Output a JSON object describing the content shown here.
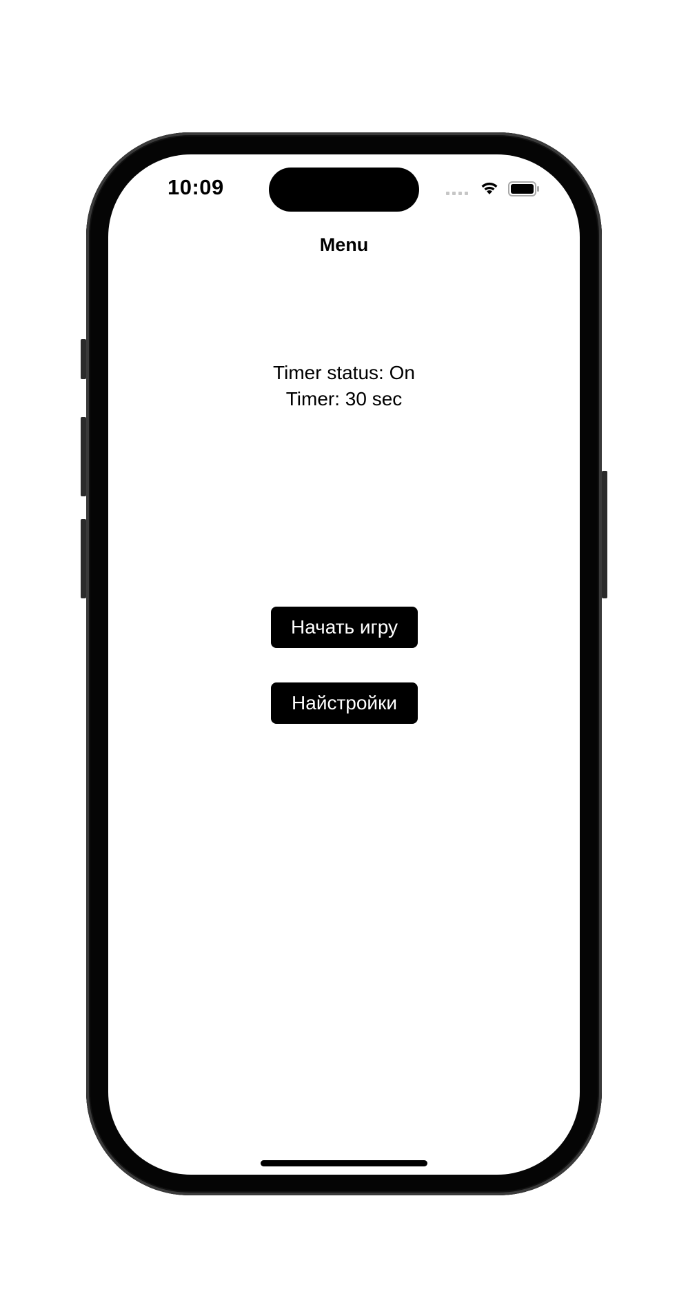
{
  "status_bar": {
    "time": "10:09",
    "icons": [
      "cellular-signal-icon",
      "wifi-icon",
      "battery-icon"
    ]
  },
  "nav": {
    "title": "Menu"
  },
  "main": {
    "timer_status": "Timer status: On",
    "timer_value": "Timer: 30 sec",
    "start_button_label": "Начать игру",
    "settings_button_label": "Найстройки"
  },
  "colors": {
    "background": "#ffffff",
    "button_background": "#000000",
    "button_text": "#ffffff",
    "text": "#000000"
  }
}
